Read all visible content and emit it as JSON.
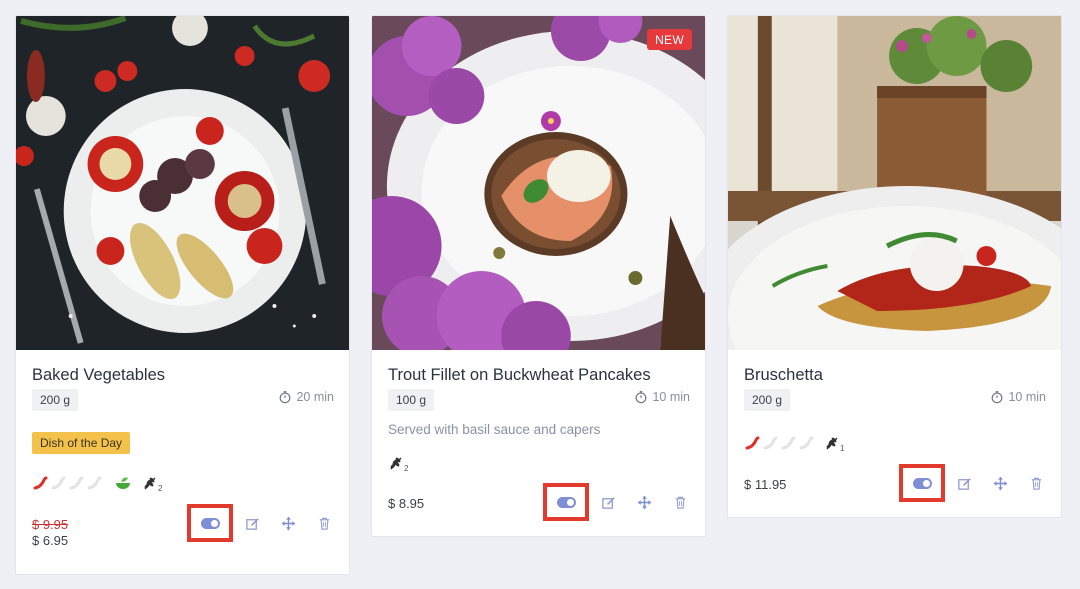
{
  "cards": [
    {
      "title": "Baked Vegetables",
      "weight": "200 g",
      "time": "20 min",
      "tag": "Dish of the Day",
      "old_price": "$ 9.95",
      "price": "$ 6.95",
      "spice_level": 1,
      "spice_max": 4,
      "vegan": true,
      "gluten_count": "2",
      "toggle_on": true
    },
    {
      "title": "Trout Fillet on Buckwheat Pancakes",
      "weight": "100 g",
      "time": "10 min",
      "badge": "NEW",
      "description": "Served with basil sauce and capers",
      "price": "$ 8.95",
      "gluten_count": "2",
      "toggle_on": true
    },
    {
      "title": "Bruschetta",
      "weight": "200 g",
      "time": "10 min",
      "price": "$ 11.95",
      "spice_level": 1,
      "spice_max": 4,
      "gluten_count": "1",
      "toggle_on": true
    }
  ],
  "colors": {
    "accent": "#7f8fd6",
    "highlight_border": "#e23a2d",
    "new_badge": "#e5393b",
    "dish_of_day": "#f2c24a",
    "chili": "#d9322b"
  },
  "icons": {
    "time": "stopwatch-icon",
    "spice": "chili-pepper-icon",
    "vegan": "leaf-bowl-icon",
    "gluten": "wheat-icon",
    "toggle": "toggle-switch-icon",
    "edit": "edit-icon",
    "move": "move-arrows-icon",
    "delete": "trash-icon"
  }
}
